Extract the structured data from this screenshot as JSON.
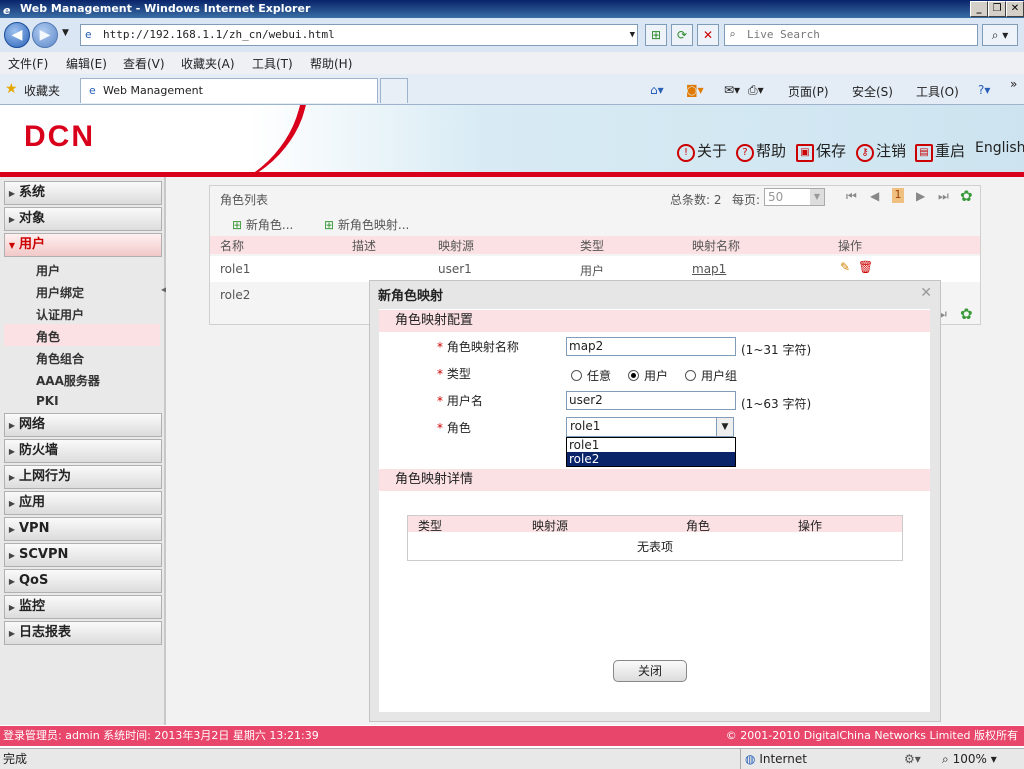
{
  "window": {
    "title": "Web Management - Windows Internet Explorer"
  },
  "addressbar": {
    "url": "http://192.168.1.1/zh_cn/webui.html",
    "search_placeholder": "Live Search"
  },
  "menubar": {
    "items": [
      "文件(F)",
      "编辑(E)",
      "查看(V)",
      "收藏夹(A)",
      "工具(T)",
      "帮助(H)"
    ]
  },
  "tabbar": {
    "favorites": "收藏夹",
    "tab_title": "Web Management",
    "tools": [
      "页面(P)",
      "安全(S)",
      "工具(O)"
    ]
  },
  "header": {
    "logo": "DCN",
    "links": [
      "关于",
      "帮助",
      "保存",
      "注销",
      "重启",
      "English"
    ]
  },
  "sidebar": {
    "items": [
      "系统",
      "对象",
      "用户",
      "网络",
      "防火墙",
      "上网行为",
      "应用",
      "VPN",
      "SCVPN",
      "QoS",
      "监控",
      "日志报表"
    ],
    "subitems": [
      "用户",
      "用户绑定",
      "认证用户",
      "角色",
      "角色组合",
      "AAA服务器",
      "PKI"
    ]
  },
  "rolelist": {
    "title": "角色列表",
    "total_label": "总条数: 2",
    "perpage_label": "每页:",
    "perpage_value": "50",
    "page": "1",
    "new_role": "新角色...",
    "new_mapping": "新角色映射...",
    "columns": [
      "名称",
      "描述",
      "映射源",
      "类型",
      "映射名称",
      "操作"
    ],
    "rows": [
      {
        "name": "role1",
        "source": "user1",
        "type": "用户",
        "mapping": "map1"
      },
      {
        "name": "role2"
      }
    ]
  },
  "modal": {
    "title": "新角色映射",
    "section1": "角色映射配置",
    "fields": {
      "name_label": "角色映射名称",
      "name_value": "map2",
      "name_hint": "(1~31 字符)",
      "type_label": "类型",
      "type_options": [
        "任意",
        "用户",
        "用户组"
      ],
      "type_selected": "用户",
      "user_label": "用户名",
      "user_value": "user2",
      "user_hint": "(1~63 字符)",
      "role_label": "角色",
      "role_value": "role1",
      "role_options": [
        "role1",
        "role2"
      ]
    },
    "section2": "角色映射详情",
    "detail_columns": [
      "类型",
      "映射源",
      "角色",
      "操作"
    ],
    "empty_text": "无表项",
    "close_button": "关闭"
  },
  "footer": {
    "left": "登录管理员: admin 系统时间: 2013年3月2日 星期六 13:21:39",
    "right": "© 2001-2010 DigitalChina Networks Limited 版权所有"
  },
  "statusbar": {
    "left": "完成",
    "zone": "Internet",
    "zoom": "100%"
  }
}
